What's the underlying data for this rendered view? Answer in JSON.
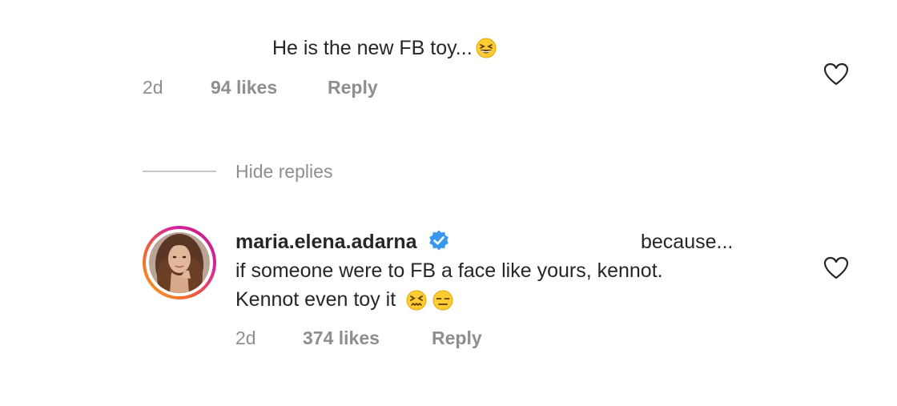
{
  "comment": {
    "text": "He is the new FB toy...",
    "emoji_icon": "grinning-squinting-face-emoji",
    "time": "2d",
    "likes": "94 likes",
    "reply_label": "Reply",
    "like_icon": "heart-outline-icon"
  },
  "replies_toggle": {
    "label": "Hide replies"
  },
  "reply": {
    "username": "maria.elena.adarna",
    "verified_icon": "verified-badge-icon",
    "line1_suffix": "because...",
    "line2": "if someone were to FB a face like yours, kennot.",
    "line3": "Kennot even toy it",
    "emoji_icons": [
      "confounded-face-emoji",
      "expressionless-face-emoji"
    ],
    "time": "2d",
    "likes": "374 likes",
    "reply_label": "Reply",
    "like_icon": "heart-outline-icon"
  },
  "colors": {
    "text": "#262626",
    "secondary": "#8e8e8e",
    "verified_blue": "#3897f0",
    "divider": "#c7c7c7"
  }
}
